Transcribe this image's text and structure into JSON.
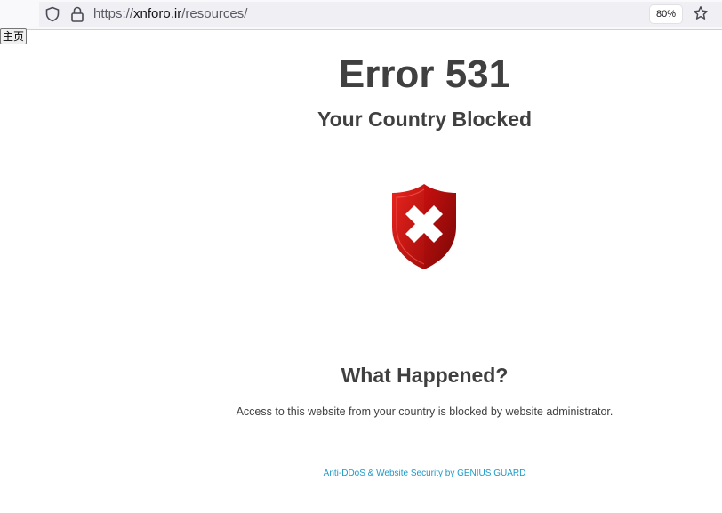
{
  "browser": {
    "url_scheme": "https://",
    "url_host": "xnforo.ir",
    "url_path": "/resources/",
    "zoom": "80%",
    "icons": [
      "shield-icon",
      "lock-icon",
      "star-icon"
    ]
  },
  "page": {
    "home_button": "主页",
    "error_title": "Error 531",
    "subtitle": "Your Country Blocked",
    "section_title": "What Happened?",
    "message": "Access to this website from your country is blocked by website administrator.",
    "footer": "Anti-DDoS & Website Security by GENIUS GUARD"
  },
  "colors": {
    "heading": "#404040",
    "footer_link": "#1a9ac9",
    "shield_red": "#c8100f"
  }
}
